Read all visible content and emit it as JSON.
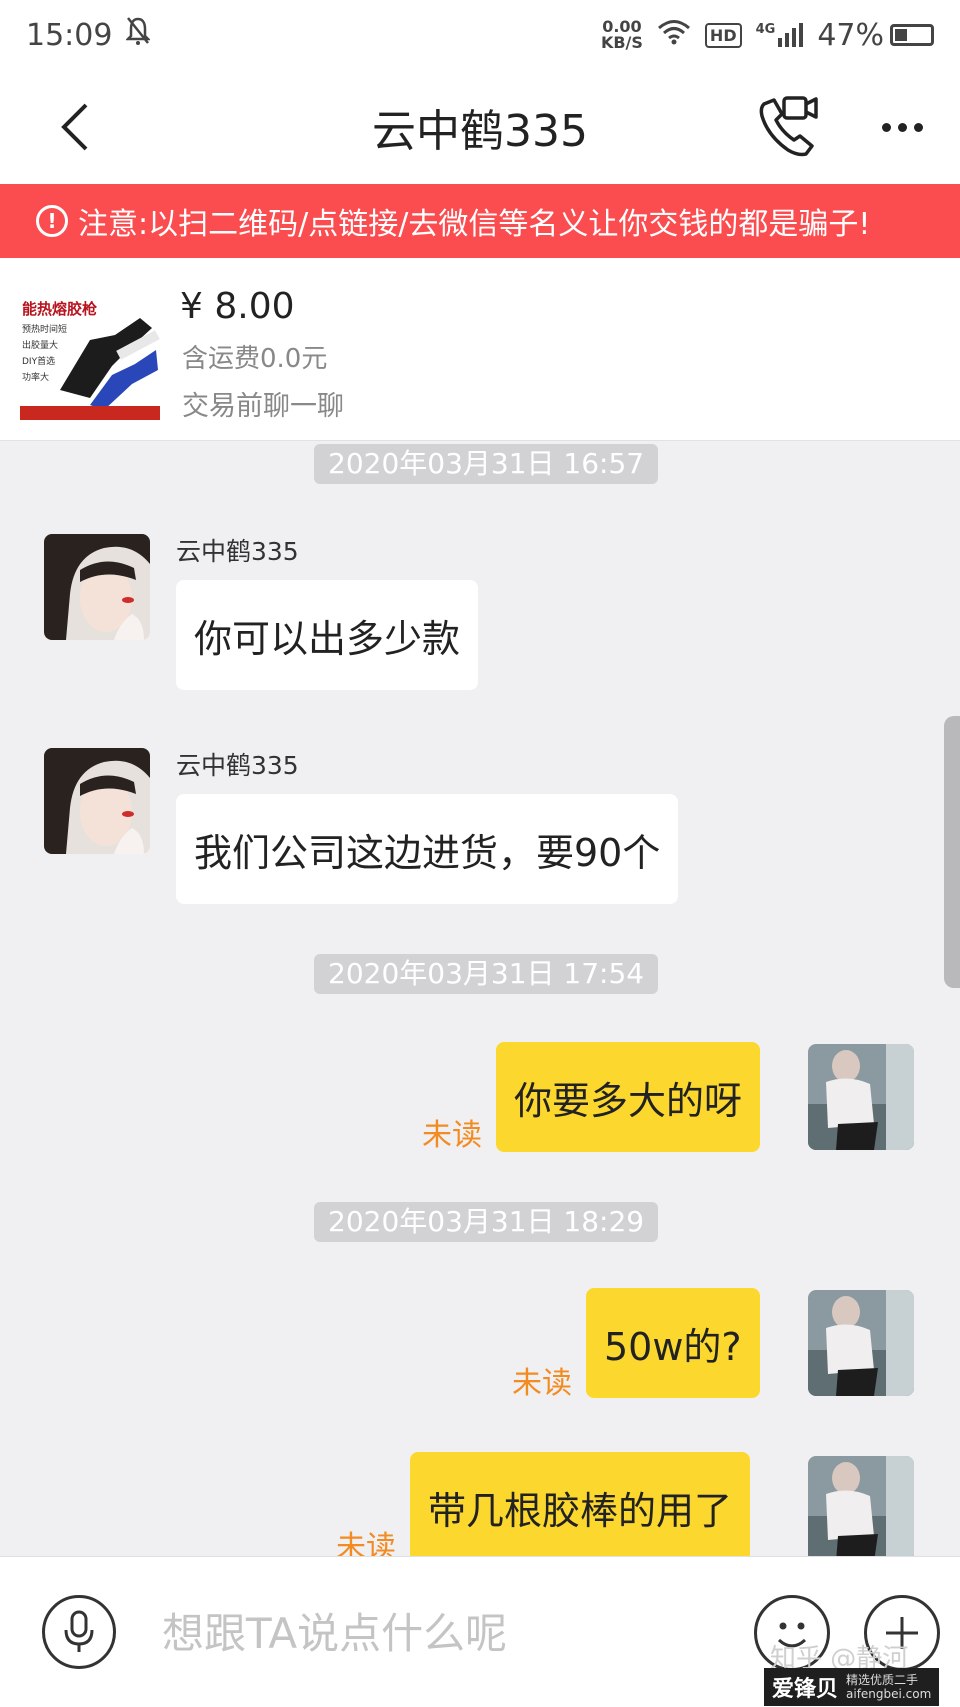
{
  "status_bar": {
    "time": "15:09",
    "net_speed_value": "0.00",
    "net_speed_unit": "KB/S",
    "hd": "HD",
    "network": "4G",
    "battery": "47%"
  },
  "nav": {
    "title": "云中鹤335"
  },
  "warning": {
    "text": "注意:以扫二维码/点链接/去微信等名义让你交钱的都是骗子!"
  },
  "product": {
    "price": "¥ 8.00",
    "shipping": "含运费0.0元",
    "chat_link": "交易前聊一聊",
    "thumb_title": "能热熔胶枪",
    "thumb_lines": [
      "预热时间短",
      "出胶量大",
      "DIY首选",
      "功率大"
    ]
  },
  "chat": {
    "timestamps": [
      "2020年03月31日 16:57",
      "2020年03月31日 17:54",
      "2020年03月31日 18:29"
    ],
    "incoming": [
      {
        "name": "云中鹤335",
        "text": "你可以出多少款"
      },
      {
        "name": "云中鹤335",
        "text": "我们公司这边进货，要90个"
      }
    ],
    "outgoing": [
      {
        "status": "未读",
        "text": "你要多大的呀"
      },
      {
        "status": "未读",
        "text": "50w的?"
      },
      {
        "status": "未读",
        "text": "带几根胶棒的用了"
      }
    ]
  },
  "input": {
    "placeholder": "想跟TA说点什么呢"
  },
  "watermark": {
    "zhihu": "知乎 @静河",
    "site_name": "爱锋贝",
    "site_tagline": "精选优质二手",
    "site_url": "aifengbei.com"
  },
  "colors": {
    "warning_bg": "#fb4d50",
    "outgoing_bubble": "#fcd82f",
    "unread": "#f28b22"
  }
}
